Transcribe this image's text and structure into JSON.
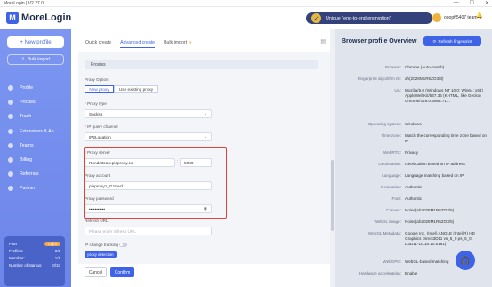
{
  "window": {
    "title": "MoreLogin | V2.27.0",
    "controls": [
      "—",
      "☐",
      "✕"
    ]
  },
  "header": {
    "brand": "MoreLogin",
    "encryption_pill": "Unique \"end-to-end encryption\"",
    "username": "ooopft5407 team",
    "icons": [
      "bell-icon",
      "mail-icon",
      "download-icon"
    ]
  },
  "sidebar": {
    "new_profile": "+ New profile",
    "bulk_import": "Bulk import",
    "items": [
      {
        "label": "Profile",
        "icon": "profile-icon"
      },
      {
        "label": "Proxies",
        "icon": "globe-icon"
      },
      {
        "label": "Trash",
        "icon": "trash-icon"
      },
      {
        "label": "Extensions & Ap...",
        "icon": "puzzle-icon"
      },
      {
        "label": "Teams",
        "icon": "team-icon"
      },
      {
        "label": "Billing",
        "icon": "wallet-icon"
      },
      {
        "label": "Referrals",
        "icon": "gift-icon"
      },
      {
        "label": "Partner",
        "icon": "star-icon"
      }
    ],
    "plan": {
      "label": "Plan",
      "badge": "Light",
      "rows": [
        {
          "k": "Profiles:",
          "v": "0/2"
        },
        {
          "k": "Member:",
          "v": "1/1"
        },
        {
          "k": "Number of startup:",
          "v": "0/10"
        }
      ]
    }
  },
  "tabs": [
    {
      "label": "Quick create",
      "active": false
    },
    {
      "label": "Advanced create",
      "active": true
    },
    {
      "label": "Bulk import",
      "active": false
    }
  ],
  "form": {
    "section_title": "Proxies",
    "proxy_option_label": "Proxy Option",
    "proxy_option_new": "New proxy",
    "proxy_option_existing": "Use existing proxy",
    "proxy_type_label": "Proxy type",
    "proxy_type_value": "Socks5",
    "ip_query_label": "IP query channel",
    "ip_query_value": "IP2Location",
    "proxy_server_label": "Proxy server",
    "proxy_server_host": "Ronde3caw.piaproxy.co",
    "proxy_server_port": "5000",
    "proxy_account_label": "Proxy account",
    "proxy_account_value": "piaproxy1_G1mvd",
    "proxy_password_label": "Proxy password",
    "proxy_password_value": "•••••••••••",
    "refresh_url_label": "Refresh URL",
    "refresh_url_placeholder": "Please enter refresh URL",
    "ip_change_label": "IP change tracking",
    "proxy_detection": "proxy detection"
  },
  "footer": {
    "cancel": "Cancel",
    "confirm": "Confirm"
  },
  "overview": {
    "title": "Browser profile Overview",
    "refresh": "Refresh fingerprint",
    "rows": [
      {
        "k": "Browser:",
        "v": "Chrome (Auto-match)"
      },
      {
        "k": "Fingerprint algorithm ID:",
        "v": "ah(2028M1R6ZO3/3)"
      },
      {
        "k": "UA:",
        "v": "Mozilla/5.0 (Windows NT 10.0; Win64; x64) AppleWebKit/537.36 (KHTML, like Gecko) Chrome/129.0.6668.71..."
      },
      {
        "k": "Operating system:",
        "v": "Windows"
      },
      {
        "k": "Time zone:",
        "v": "Match the corresponding time zone based on IP"
      },
      {
        "k": "WebRTC:",
        "v": "Privacy"
      },
      {
        "k": "Geolocation:",
        "v": "Geolocation based on IP address"
      },
      {
        "k": "Language:",
        "v": "Language matching based on IP"
      },
      {
        "k": "Resolution:",
        "v": "Authentic"
      },
      {
        "k": "Font:",
        "v": "Authentic"
      },
      {
        "k": "Canvas:",
        "v": "Noise(ah2028M1R6ZO3/5)"
      },
      {
        "k": "WebGL image:",
        "v": "Noise(ah2028M1R6ZO3/5)"
      },
      {
        "k": "WebGL Metadata:",
        "v": "Google Inc. (Intel) ANGLE (Intel(R) HD Graphics Direct3D11 vs_5_0 ps_5_0, D3D11-10.18.10.5161)"
      },
      {
        "k": "WebGPU:",
        "v": "WebGL-based matching"
      },
      {
        "k": "Hardware acceleration:",
        "v": "Enable"
      }
    ]
  }
}
